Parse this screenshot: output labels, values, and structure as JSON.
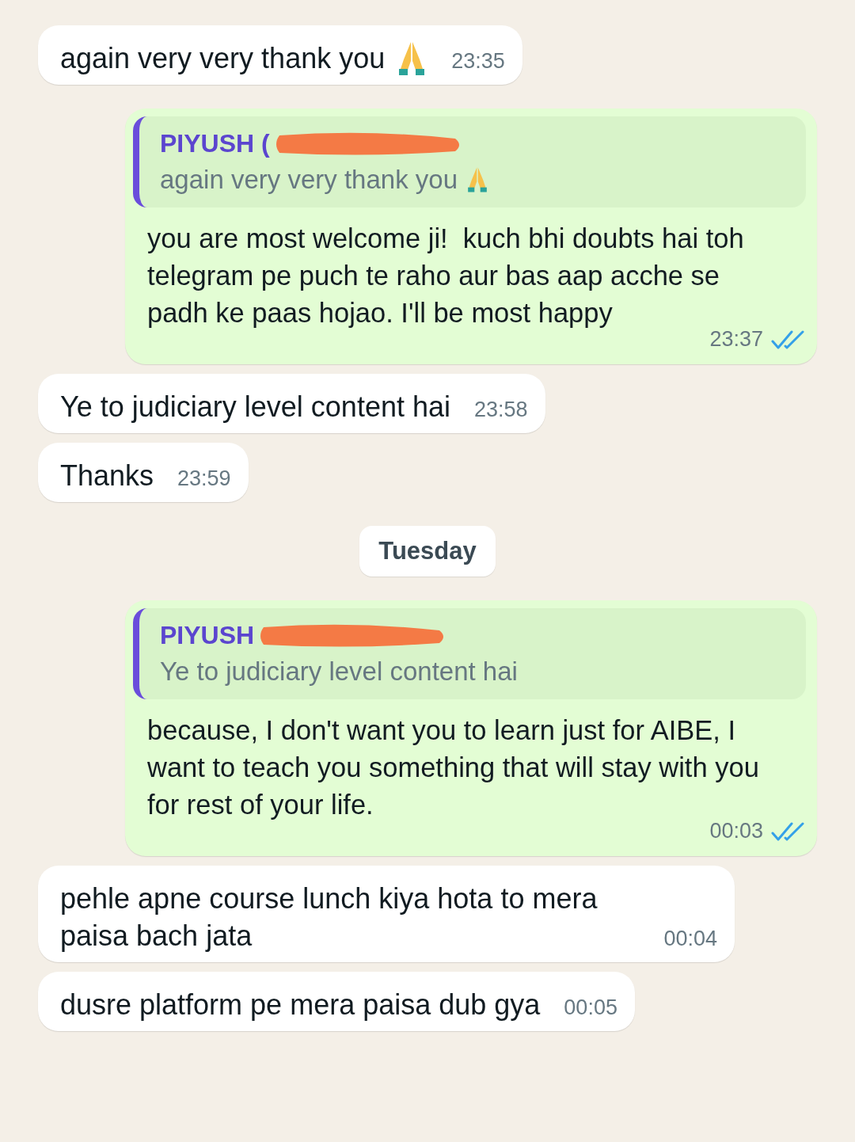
{
  "messages": [
    {
      "kind": "incoming",
      "text": "again very very thank you",
      "emoji": true,
      "time": "23:35"
    },
    {
      "kind": "outgoing",
      "quote": {
        "author": "PIYUSH (",
        "redacted": true,
        "text": "again very very thank you",
        "emoji": true
      },
      "text": "you are most welcome ji!  kuch bhi doubts hai toh telegram pe puch te raho aur bas aap acche se padh ke paas hojao. I'll be most happy",
      "time": "23:37",
      "read": true
    },
    {
      "kind": "incoming",
      "text": "Ye to judiciary level content hai",
      "time": "23:58"
    },
    {
      "kind": "incoming",
      "text": "Thanks",
      "time": "23:59"
    },
    {
      "kind": "date",
      "text": "Tuesday"
    },
    {
      "kind": "outgoing",
      "quote": {
        "author": "PIYUSH",
        "redacted": true,
        "text": "Ye to judiciary level content hai"
      },
      "text": "because, I don't want you to learn just for AIBE, I want to teach you something that will stay with you for rest of your life.",
      "time": "00:03",
      "read": true
    },
    {
      "kind": "incoming",
      "text": "pehle apne course lunch kiya hota to mera paisa bach jata",
      "time": "00:04"
    },
    {
      "kind": "incoming",
      "text": "dusre platform pe mera paisa dub gya",
      "time": "00:05"
    }
  ]
}
